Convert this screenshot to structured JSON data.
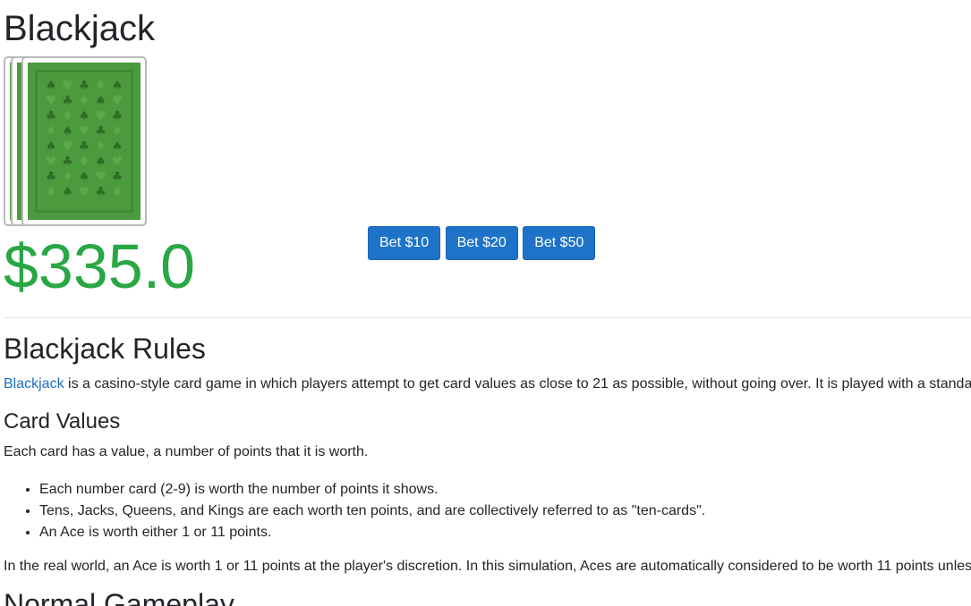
{
  "header": {
    "title": "Blackjack"
  },
  "deck": {
    "card_back_color": "#4c9a3e",
    "card_count": 3,
    "pattern": [
      "spade-icon",
      "heart-icon",
      "club-icon",
      "diamond-icon"
    ]
  },
  "wallet": {
    "balance": "$335.0",
    "color": "#28a745"
  },
  "bets": {
    "buttons": [
      {
        "label": "Bet $10"
      },
      {
        "label": "Bet $20"
      },
      {
        "label": "Bet $50"
      }
    ],
    "color": "#1e73c8"
  },
  "rules": {
    "title": "Blackjack Rules",
    "intro_link": "Blackjack",
    "intro_text": " is a casino-style card game in which players attempt to get card values as close to 21 as possible, without going over. It is played with a standa",
    "card_values": {
      "title": "Card Values",
      "description": "Each card has a value, a number of points that it is worth.",
      "items": [
        "Each number card (2-9) is worth the number of points it shows.",
        "Tens, Jacks, Queens, and Kings are each worth ten points, and are collectively referred to as \"ten-cards\".",
        "An Ace is worth either 1 or 11 points."
      ],
      "real_world": "In the real world, an Ace is worth 1 or 11 points at the player's discretion. In this simulation, Aces are automatically considered to be worth 11 points unles"
    },
    "gameplay_title": "Normal Gameplay"
  }
}
